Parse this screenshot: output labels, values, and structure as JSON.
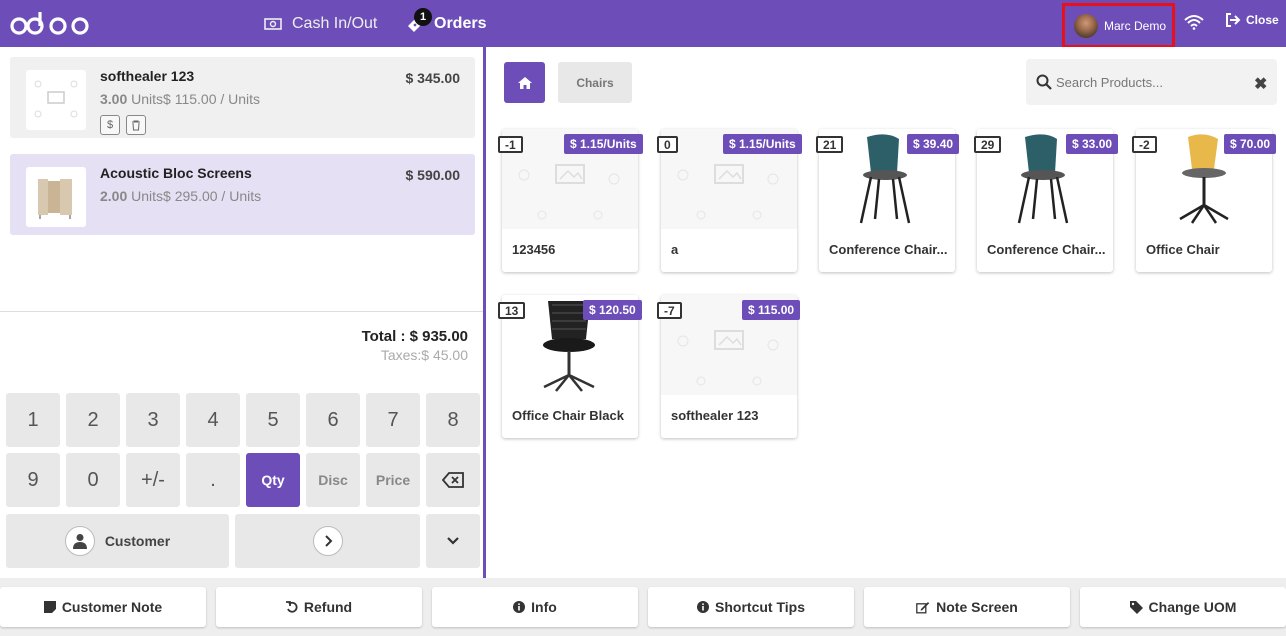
{
  "header": {
    "cash_label": "Cash In/Out",
    "orders_label": "Orders",
    "orders_badge": "1",
    "user_name": "Marc Demo",
    "close_label": "Close",
    "accent_color": "#6d4eb8"
  },
  "order": {
    "lines": [
      {
        "name": "softhealer 123",
        "qty": "3.00",
        "unit_text": "Units$ 115.00 / Units",
        "price": "$ 345.00"
      },
      {
        "name": "Acoustic Bloc Screens",
        "qty": "2.00",
        "unit_text": "Units$ 295.00 / Units",
        "price": "$ 590.00"
      }
    ],
    "total": "Total : $ 935.00",
    "taxes": "Taxes:$ 45.00"
  },
  "numpad": {
    "row1": [
      "1",
      "2",
      "3",
      "4",
      "5",
      "6",
      "7",
      "8"
    ],
    "row2": [
      "9",
      "0",
      "+/-",
      "."
    ],
    "modes": [
      "Qty",
      "Disc",
      "Price"
    ],
    "active_mode": "Qty",
    "customer_label": "Customer"
  },
  "products": {
    "category": "Chairs",
    "search_placeholder": "Search Products...",
    "items": [
      {
        "name": "123456",
        "qty": "-1",
        "price": "$ 1.15/Units"
      },
      {
        "name": "a",
        "qty": "0",
        "price": "$ 1.15/Units"
      },
      {
        "name": "Conference Chair...",
        "qty": "21",
        "price": "$ 39.40"
      },
      {
        "name": "Conference Chair...",
        "qty": "29",
        "price": "$ 33.00"
      },
      {
        "name": "Office Chair",
        "qty": "-2",
        "price": "$ 70.00"
      },
      {
        "name": "Office Chair Black",
        "qty": "13",
        "price": "$ 120.50"
      },
      {
        "name": "softhealer 123",
        "qty": "-7",
        "price": "$ 115.00"
      }
    ]
  },
  "bottom": {
    "buttons": [
      "Customer Note",
      "Refund",
      "Info",
      "Shortcut Tips",
      "Note Screen",
      "Change UOM"
    ]
  }
}
